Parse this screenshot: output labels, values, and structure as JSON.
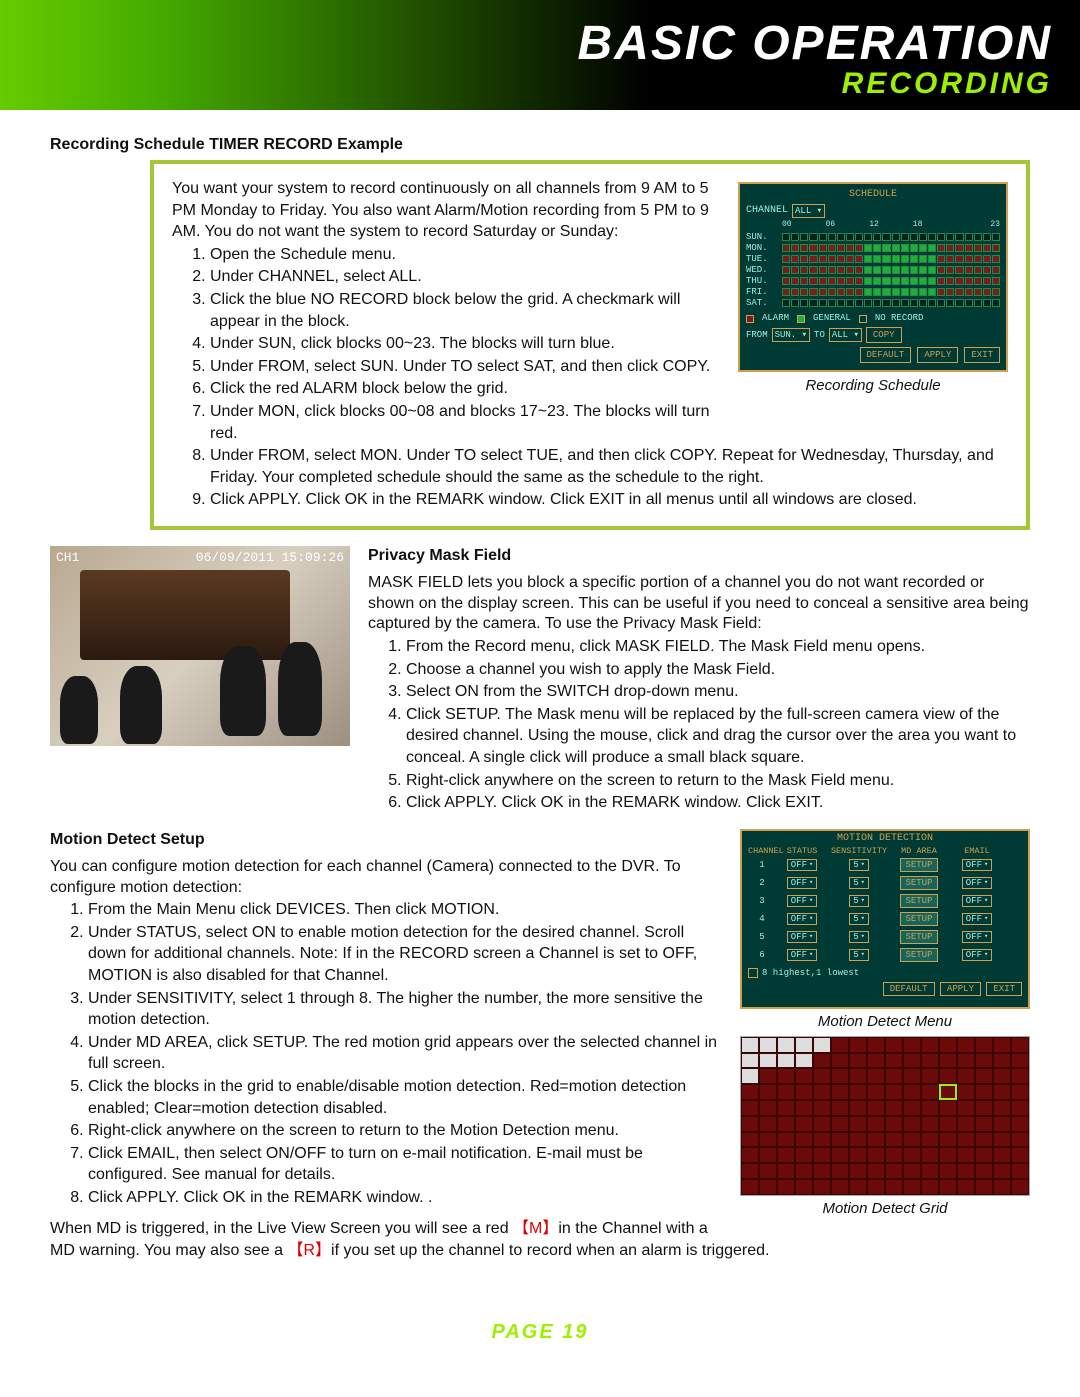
{
  "header": {
    "title1": "Basic Operation",
    "title2": "Recording"
  },
  "section1": {
    "heading": "Recording Schedule TIMER RECORD Example",
    "intro": "You want your system to record continuously on all channels from 9 AM to 5 PM Monday to Friday. You also want Alarm/Motion recording from 5 PM to 9 AM. You do not want the system to record Saturday or Sunday:",
    "steps": [
      "Open the Schedule menu.",
      "Under CHANNEL, select ALL.",
      "Click the blue NO RECORD block below the grid. A checkmark will appear in the block.",
      "Under SUN, click blocks 00~23. The blocks will turn blue.",
      "Under FROM, select SUN. Under TO select SAT, and then click COPY.",
      "Click the red ALARM block below the grid.",
      "Under MON, click blocks 00~08 and blocks 17~23. The blocks will turn red.",
      "Under FROM, select MON. Under TO select TUE, and then click COPY. Repeat for Wednesday, Thursday, and Friday. Your completed schedule should the same as the schedule to the right.",
      "Click APPLY. Click OK in the REMARK window. Click EXIT in all menus until all windows are closed."
    ],
    "fig_caption": "Recording Schedule"
  },
  "schedule_ui": {
    "title": "SCHEDULE",
    "channel_label": "CHANNEL",
    "channel_value": "ALL",
    "hours": [
      "00",
      "06",
      "12",
      "18",
      "23"
    ],
    "days": [
      "SUN.",
      "MON.",
      "TUE.",
      "WED.",
      "THU.",
      "FRI.",
      "SAT."
    ],
    "legend": {
      "alarm": "ALARM",
      "general": "GENERAL",
      "norecord": "NO RECORD"
    },
    "from_label": "FROM",
    "from_value": "SUN.",
    "to_label": "TO",
    "to_value": "ALL",
    "copy": "COPY",
    "buttons": {
      "default": "DEFAULT",
      "apply": "APPLY",
      "exit": "EXIT"
    }
  },
  "section2": {
    "heading": "Privacy Mask Field",
    "intro": "MASK FIELD lets you block a specific portion of a channel you do not want recorded or shown on the display screen. This can be useful if you need to conceal a sensitive area being captured by the camera. To use the Privacy Mask Field:",
    "steps": [
      "From the Record menu, click MASK FIELD. The Mask Field menu opens.",
      "Choose a channel you wish to apply the Mask Field.",
      "Select ON from the SWITCH drop-down menu.",
      "Click SETUP. The Mask menu will be replaced by the full-screen camera view of the desired channel. Using the mouse, click and drag the cursor over the area you want to conceal. A single click will produce a small black square.",
      "Right-click anywhere on the screen to return to the Mask Field menu.",
      "Click APPLY. Click OK in the REMARK window. Click EXIT."
    ],
    "cctv": {
      "ch": "CH1",
      "timestamp": "06/09/2011 15:09:26"
    }
  },
  "section3": {
    "heading": "Motion Detect Setup",
    "intro": "You can configure motion detection for each channel (Camera) connected to the DVR. To configure motion detection:",
    "steps": [
      "From the Main Menu click DEVICES. Then click MOTION.",
      "Under STATUS, select ON to enable motion detection for the desired channel. Scroll down for additional channels. Note: If in the RECORD screen a Channel is set to OFF, MOTION is also disabled for that Channel.",
      "Under SENSITIVITY, select 1 through 8. The higher the number, the more sensitive the motion detection.",
      "Under MD AREA, click SETUP. The red motion grid appears over the selected channel in full screen.",
      "Click the blocks in the grid to enable/disable motion detection. Red=motion detection enabled; Clear=motion detection disabled.",
      "Right-click anywhere on the screen to return to the Motion Detection menu.",
      "Click EMAIL, then select ON/OFF to turn on e-mail notification. E-mail must be configured. See manual for details.",
      "Click APPLY. Click OK in the REMARK window. ."
    ],
    "after_p1a": "When MD is triggered, in the Live View Screen you will see a red ",
    "after_m": "【M】",
    "after_p1b": "in the Channel with a MD warning. You may also see a ",
    "after_r": "【R】",
    "after_p1c": "if you set up the channel to record when an alarm is triggered.",
    "fig1_caption": "Motion Detect Menu",
    "fig2_caption": "Motion Detect Grid"
  },
  "motion_ui": {
    "title": "MOTION DETECTION",
    "cols": {
      "channel": "CHANNEL",
      "status": "STATUS",
      "sensitivity": "SENSITIVITY",
      "mdarea": "MD AREA",
      "email": "EMAIL"
    },
    "rows": [
      {
        "ch": "1",
        "status": "OFF",
        "sens": "5",
        "md": "SETUP",
        "email": "OFF"
      },
      {
        "ch": "2",
        "status": "OFF",
        "sens": "5",
        "md": "SETUP",
        "email": "OFF"
      },
      {
        "ch": "3",
        "status": "OFF",
        "sens": "5",
        "md": "SETUP",
        "email": "OFF"
      },
      {
        "ch": "4",
        "status": "OFF",
        "sens": "5",
        "md": "SETUP",
        "email": "OFF"
      },
      {
        "ch": "5",
        "status": "OFF",
        "sens": "5",
        "md": "SETUP",
        "email": "OFF"
      },
      {
        "ch": "6",
        "status": "OFF",
        "sens": "5",
        "md": "SETUP",
        "email": "OFF"
      }
    ],
    "footer": "8  highest,1  lowest",
    "buttons": {
      "default": "DEFAULT",
      "apply": "APPLY",
      "exit": "EXIT"
    }
  },
  "footer": {
    "page": "Page 19"
  }
}
